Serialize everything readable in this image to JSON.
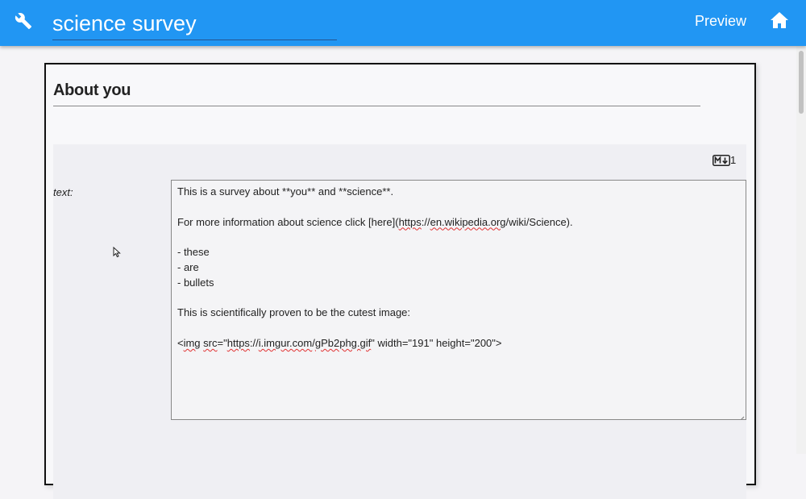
{
  "appbar": {
    "title": "science survey",
    "preview_label": "Preview",
    "settings_icon": "wrench-icon",
    "home_icon": "home-icon",
    "color": "#2196f3"
  },
  "section": {
    "title": "About you",
    "markdown_badge": "markdown-icon",
    "markdown_count": "1",
    "field_label": "text:",
    "text_lines": [
      "This is a survey about **you** and **science**.",
      "",
      "For more information about science click [here](https://en.wikipedia.org/wiki/Science).",
      "",
      "- these",
      "- are",
      "- bullets",
      "",
      "This is scientifically proven to be the cutest image:",
      "",
      "<img src=\"https://i.imgur.com/gPb2phg.gif\" width=\"191\" height=\"200\">"
    ]
  }
}
